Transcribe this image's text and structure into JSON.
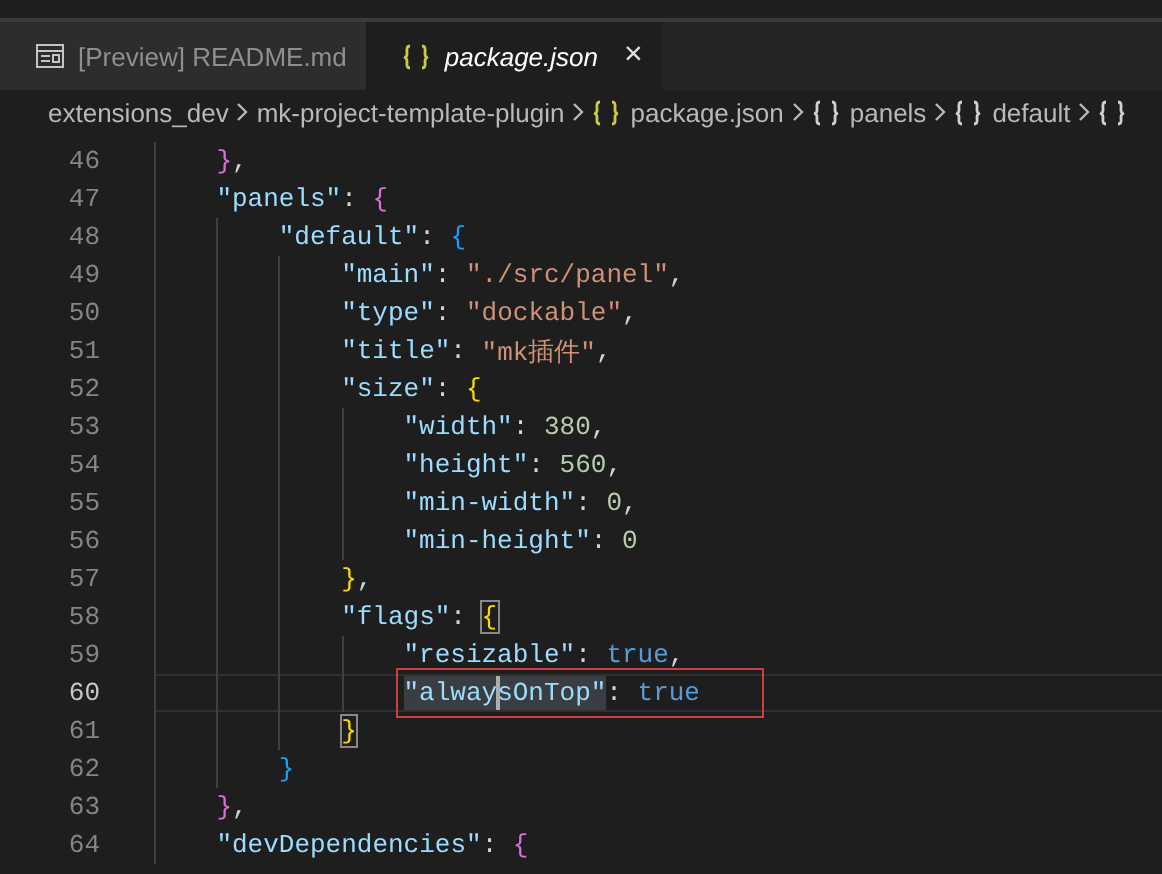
{
  "tabs": [
    {
      "label": "[Preview] README.md",
      "kind": "preview",
      "selected": false,
      "italic": false
    },
    {
      "label": "package.json",
      "kind": "json",
      "selected": true,
      "italic": true,
      "close": "×"
    }
  ],
  "breadcrumb": [
    {
      "kind": "folder",
      "label": "extensions_dev"
    },
    {
      "kind": "folder",
      "label": "mk-project-template-plugin"
    },
    {
      "kind": "file",
      "label": "package.json"
    },
    {
      "kind": "object",
      "label": "panels"
    },
    {
      "kind": "object",
      "label": "default"
    },
    {
      "kind": "object"
    }
  ],
  "editor": {
    "lines": [
      {
        "number": "46",
        "current": false,
        "boxed": false,
        "tokens": [
          {
            "kind": "bracket",
            "text": "    }",
            "color": "#da70d6",
            "matched": false
          },
          {
            "kind": "punct",
            "text": ","
          }
        ]
      },
      {
        "number": "47",
        "current": false,
        "boxed": false,
        "tokens": [
          {
            "kind": "key",
            "text": "    \"panels\""
          },
          {
            "kind": "punct",
            "text": ": "
          },
          {
            "kind": "bracket",
            "text": "{",
            "color": "#da70d6",
            "matched": false
          }
        ]
      },
      {
        "number": "48",
        "current": false,
        "boxed": false,
        "tokens": [
          {
            "kind": "key",
            "text": "        \"default\""
          },
          {
            "kind": "punct",
            "text": ": "
          },
          {
            "kind": "bracket",
            "text": "{",
            "color": "#179fff",
            "matched": false
          }
        ]
      },
      {
        "number": "49",
        "current": false,
        "boxed": false,
        "tokens": [
          {
            "kind": "key",
            "text": "            \"main\""
          },
          {
            "kind": "punct",
            "text": ": "
          },
          {
            "kind": "string",
            "text": "\"./src/panel\""
          },
          {
            "kind": "punct",
            "text": ","
          }
        ]
      },
      {
        "number": "50",
        "current": false,
        "boxed": false,
        "tokens": [
          {
            "kind": "key",
            "text": "            \"type\""
          },
          {
            "kind": "punct",
            "text": ": "
          },
          {
            "kind": "string",
            "text": "\"dockable\""
          },
          {
            "kind": "punct",
            "text": ","
          }
        ]
      },
      {
        "number": "51",
        "current": false,
        "boxed": false,
        "tokens": [
          {
            "kind": "key",
            "text": "            \"title\""
          },
          {
            "kind": "punct",
            "text": ": "
          },
          {
            "kind": "string",
            "text": "\"mk插件\""
          },
          {
            "kind": "punct",
            "text": ","
          }
        ]
      },
      {
        "number": "52",
        "current": false,
        "boxed": false,
        "tokens": [
          {
            "kind": "key",
            "text": "            \"size\""
          },
          {
            "kind": "punct",
            "text": ": "
          },
          {
            "kind": "bracket",
            "text": "{",
            "color": "#ffd700",
            "matched": false
          }
        ]
      },
      {
        "number": "53",
        "current": false,
        "boxed": false,
        "tokens": [
          {
            "kind": "key",
            "text": "                \"width\""
          },
          {
            "kind": "punct",
            "text": ": "
          },
          {
            "kind": "number",
            "text": "380"
          },
          {
            "kind": "punct",
            "text": ","
          }
        ]
      },
      {
        "number": "54",
        "current": false,
        "boxed": false,
        "tokens": [
          {
            "kind": "key",
            "text": "                \"height\""
          },
          {
            "kind": "punct",
            "text": ": "
          },
          {
            "kind": "number",
            "text": "560"
          },
          {
            "kind": "punct",
            "text": ","
          }
        ]
      },
      {
        "number": "55",
        "current": false,
        "boxed": false,
        "tokens": [
          {
            "kind": "key",
            "text": "                \"min-width\""
          },
          {
            "kind": "punct",
            "text": ": "
          },
          {
            "kind": "number",
            "text": "0"
          },
          {
            "kind": "punct",
            "text": ","
          }
        ]
      },
      {
        "number": "56",
        "current": false,
        "boxed": false,
        "tokens": [
          {
            "kind": "key",
            "text": "                \"min-height\""
          },
          {
            "kind": "punct",
            "text": ": "
          },
          {
            "kind": "number",
            "text": "0"
          }
        ]
      },
      {
        "number": "57",
        "current": false,
        "boxed": false,
        "tokens": [
          {
            "kind": "bracket",
            "text": "            }",
            "color": "#ffd700",
            "matched": false
          },
          {
            "kind": "punct",
            "text": ","
          }
        ]
      },
      {
        "number": "58",
        "current": false,
        "boxed": false,
        "tokens": [
          {
            "kind": "key",
            "text": "            \"flags\""
          },
          {
            "kind": "punct",
            "text": ": "
          },
          {
            "kind": "bracket",
            "text": "{",
            "color": "#ffd700",
            "matched": true
          }
        ]
      },
      {
        "number": "59",
        "current": false,
        "boxed": false,
        "tokens": [
          {
            "kind": "key",
            "text": "                \"resizable\""
          },
          {
            "kind": "punct",
            "text": ": "
          },
          {
            "kind": "bool",
            "text": "true"
          },
          {
            "kind": "punct",
            "text": ","
          }
        ]
      },
      {
        "number": "60",
        "current": true,
        "boxed": true,
        "tokens": [
          {
            "kind": "key",
            "text": "                \"alwaysOnTop\"",
            "highlighted": true
          },
          {
            "kind": "punct",
            "text": ": "
          },
          {
            "kind": "bool",
            "text": "true"
          }
        ]
      },
      {
        "number": "61",
        "current": false,
        "boxed": false,
        "tokens": [
          {
            "kind": "bracket",
            "text": "            }",
            "color": "#ffd700",
            "matched": true
          }
        ]
      },
      {
        "number": "62",
        "current": false,
        "boxed": false,
        "tokens": [
          {
            "kind": "bracket",
            "text": "        }",
            "color": "#179fff",
            "matched": false
          }
        ]
      },
      {
        "number": "63",
        "current": false,
        "boxed": false,
        "tokens": [
          {
            "kind": "bracket",
            "text": "    }",
            "color": "#da70d6",
            "matched": false
          },
          {
            "kind": "punct",
            "text": ","
          }
        ]
      },
      {
        "number": "64",
        "current": false,
        "boxed": false,
        "tokens": [
          {
            "kind": "key",
            "text": "    \"devDependencies\""
          },
          {
            "kind": "punct",
            "text": ": "
          },
          {
            "kind": "bracket",
            "text": "{",
            "color": "#da70d6",
            "matched": false
          }
        ]
      }
    ]
  }
}
